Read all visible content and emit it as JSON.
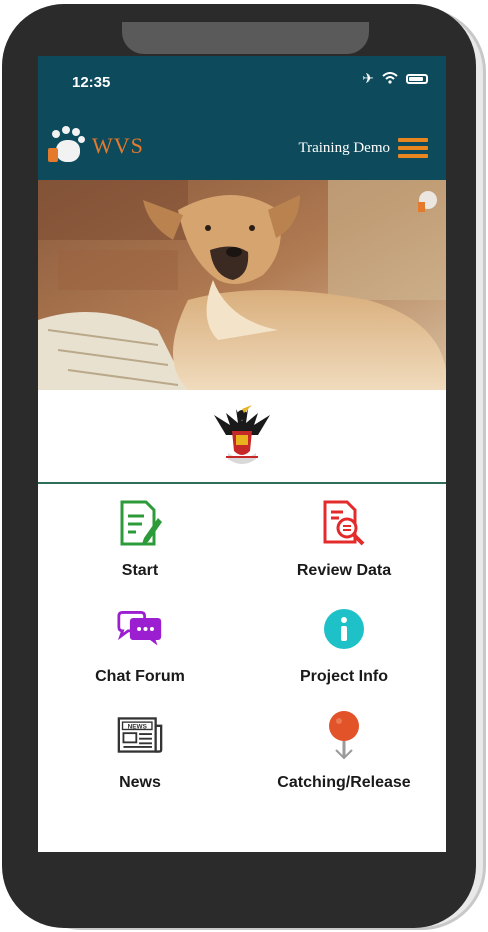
{
  "status_bar": {
    "time": "12:35"
  },
  "header": {
    "logo_text": "WVS",
    "menu_label": "Training Demo"
  },
  "menu": {
    "items": [
      {
        "label": "Start",
        "icon": "edit-document-icon",
        "color": "#2e9b3a"
      },
      {
        "label": "Review Data",
        "icon": "search-document-icon",
        "color": "#e32b2b"
      },
      {
        "label": "Chat Forum",
        "icon": "chat-bubbles-icon",
        "color": "#9b1fd1"
      },
      {
        "label": "Project Info",
        "icon": "info-icon",
        "color": "#1fc1c9"
      },
      {
        "label": "News",
        "icon": "newspaper-icon",
        "color": "#333333"
      },
      {
        "label": "Catching/Release",
        "icon": "map-pin-icon",
        "color": "#e2532a"
      }
    ]
  },
  "colors": {
    "header_bg": "#0d4b5c",
    "accent": "#e8871f"
  }
}
